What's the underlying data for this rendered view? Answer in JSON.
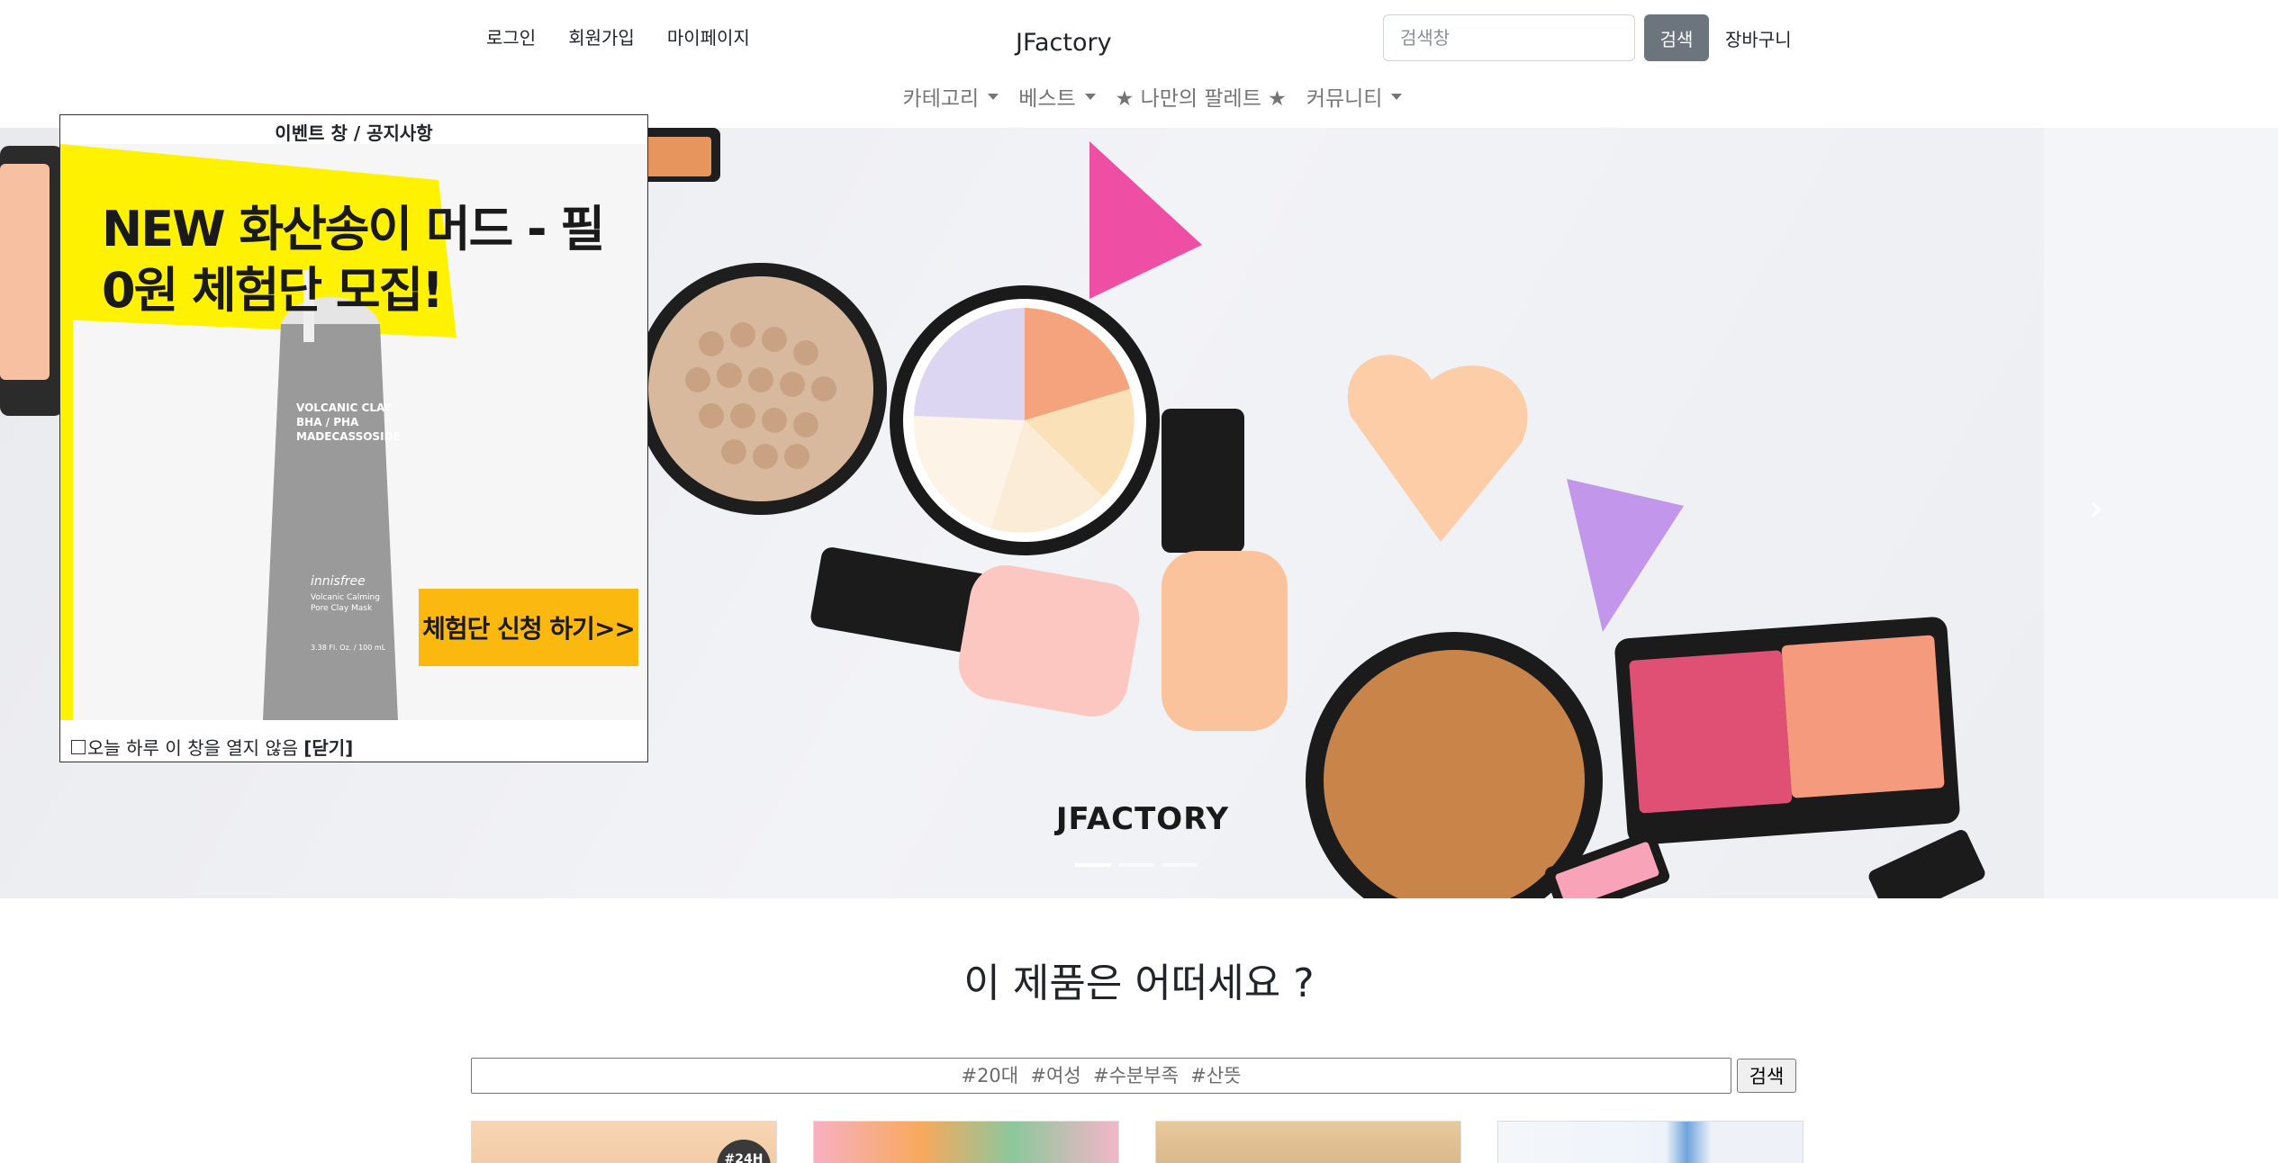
{
  "header": {
    "links": [
      "로그인",
      "회원가입",
      "마이페이지"
    ],
    "brand": "JFactory",
    "search": {
      "placeholder": "검색창",
      "button": "검색"
    },
    "cart": "장바구니"
  },
  "nav": {
    "items": [
      {
        "label": "카테고리",
        "dropdown": true
      },
      {
        "label": "베스트",
        "dropdown": true
      },
      {
        "label": "★ 나만의 팔레트 ★",
        "dropdown": false
      },
      {
        "label": "커뮤니티",
        "dropdown": true
      }
    ]
  },
  "hero": {
    "caption": "JFACTORY",
    "indicator_count": 3,
    "active_indicator": 1
  },
  "popup": {
    "title": "이벤트 창 / 공지사항",
    "banner_line1": "NEW 화산송이 머드 - 필",
    "banner_line2": "0원 체험단 모집!",
    "product_label_1": "VOLCANIC CLAY",
    "product_label_2": "BHA / PHA",
    "product_label_3": "MADECASSOSIDE",
    "product_brand": "innisfree",
    "product_name_1": "Volcanic Calming",
    "product_name_2": "Pore Clay Mask",
    "product_volume": "3.38 Fl. Oz. / 100 mL",
    "apply_button": "체험단 신청 하기>>",
    "dont_show": "오늘 하루 이 창을 열지 않음",
    "close": "[닫기]"
  },
  "recommend": {
    "title": "이 제품은 어떠세요 ?",
    "tag_placeholder": "#20대  #여성  #수분부족  #산뜻",
    "tag_button": "검색",
    "card_badge": "#24H"
  },
  "colors": {
    "search_button": "#6c757d",
    "apply_button": "#fbb80f",
    "banner_yellow": "#fff200"
  }
}
